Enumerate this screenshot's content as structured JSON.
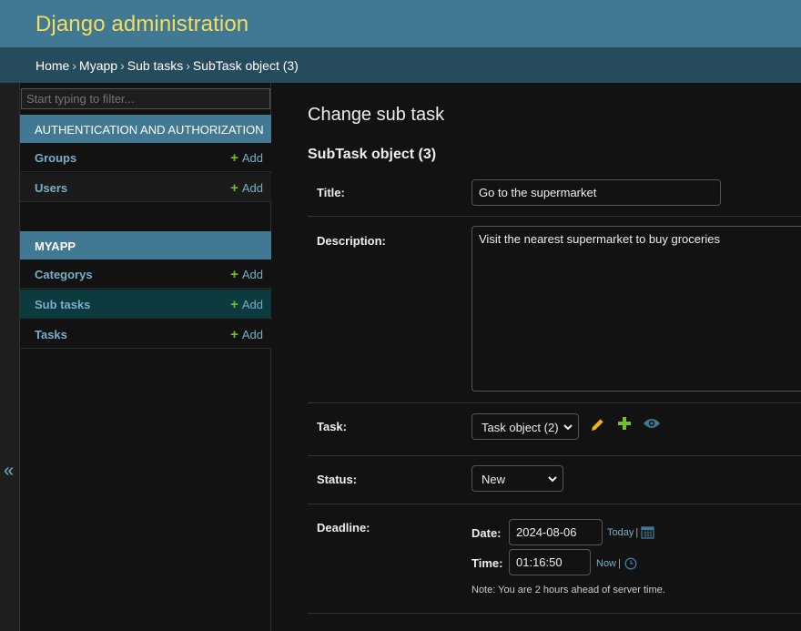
{
  "header": {
    "site_name": "Django administration"
  },
  "breadcrumbs": {
    "home": "Home",
    "app": "Myapp",
    "model": "Sub tasks",
    "current": "SubTask object (3)",
    "separator": "›"
  },
  "sidebar": {
    "toggle_label": "«",
    "filter_placeholder": "Start typing to filter...",
    "add_label": "Add",
    "add_symbol": "+",
    "apps": [
      {
        "name": "AUTHENTICATION AND AUTHORIZATION",
        "models": [
          {
            "name": "Groups"
          },
          {
            "name": "Users"
          }
        ]
      },
      {
        "name": "MYAPP",
        "models": [
          {
            "name": "Categorys"
          },
          {
            "name": "Sub tasks",
            "selected": true
          },
          {
            "name": "Tasks"
          }
        ]
      }
    ]
  },
  "main": {
    "page_title": "Change sub task",
    "object_title": "SubTask object (3)",
    "fields": {
      "title": {
        "label": "Title:",
        "value": "Go to the supermarket"
      },
      "description": {
        "label": "Description:",
        "value": "Visit the nearest supermarket to buy groceries"
      },
      "task": {
        "label": "Task:",
        "value": "Task object (2)"
      },
      "status": {
        "label": "Status:",
        "value": "New"
      },
      "deadline": {
        "label": "Deadline:",
        "date_label": "Date:",
        "date_value": "2024-08-06",
        "today_link": "Today",
        "time_label": "Time:",
        "time_value": "01:16:50",
        "now_link": "Now",
        "shortcut_separator": "|",
        "timezone_note": "Note: You are 2 hours ahead of server time."
      }
    }
  },
  "colors": {
    "header_bg": "#417893",
    "site_name": "#f5dd5d",
    "breadcrumb_bg": "#264b5d",
    "link": "#79aec8",
    "add_plus": "#70bf2b",
    "selected_row": "#0b3a3f",
    "edit_icon": "#efb80b",
    "view_icon": "#417893"
  },
  "icons": [
    "chevron-down-icon",
    "pencil-icon",
    "plus-icon",
    "eye-icon",
    "calendar-icon",
    "clock-icon"
  ]
}
